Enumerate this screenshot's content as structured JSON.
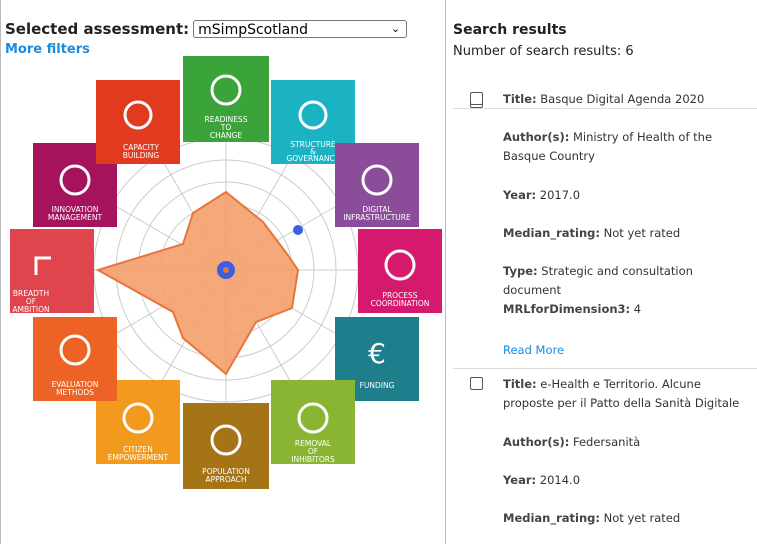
{
  "left_panel": {
    "selected_label": "Selected assessment:",
    "selected_value": "mSimpScotland",
    "more_filters": "More filters",
    "dimensions": [
      {
        "name": "READINESS TO CHANGE",
        "color": "#3aa43a"
      },
      {
        "name": "STRUCTURE & GOVERNANCE",
        "color": "#1bb3c4"
      },
      {
        "name": "DIGITAL INFRASTRUCTURE",
        "color": "#8b4d9a"
      },
      {
        "name": "PROCESS COORDINATION",
        "color": "#d51a6e"
      },
      {
        "name": "FUNDING",
        "color": "#1e7e8c"
      },
      {
        "name": "REMOVAL OF INHIBITORS",
        "color": "#8ab532"
      },
      {
        "name": "POPULATION APPROACH",
        "color": "#a57417"
      },
      {
        "name": "CITIZEN EMPOWERMENT",
        "color": "#f29a1d"
      },
      {
        "name": "EVALUATION METHODS",
        "color": "#ed6325"
      },
      {
        "name": "BREADTH OF AMBITION",
        "color": "#e0444c"
      },
      {
        "name": "INNOVATION MANAGEMENT",
        "color": "#a5135c"
      },
      {
        "name": "CAPACITY BUILDING",
        "color": "#e03a1f"
      }
    ]
  },
  "search": {
    "title": "Search results",
    "count_text": "Number of search results: 6",
    "results": [
      {
        "title_label": "Title:",
        "title": "Basque Digital Agenda 2020",
        "author_label": "Author(s):",
        "author": "Ministry of Health of the Basque Country",
        "year_label": "Year:",
        "year": "2017.0",
        "rating_label": "Median_rating:",
        "rating": "Not yet rated",
        "type_label": "Type:",
        "type": "Strategic and consultation document",
        "mrl_label": "MRLforDimension3:",
        "mrl": "4",
        "read_more": "Read More"
      },
      {
        "title_label": "Title:",
        "title": "e-Health e Territorio. Alcune proposte per il Patto della Sanità Digitale",
        "author_label": "Author(s):",
        "author": "Federsanità",
        "year_label": "Year:",
        "year": "2014.0",
        "rating_label": "Median_rating:",
        "rating": "Not yet rated"
      }
    ]
  }
}
